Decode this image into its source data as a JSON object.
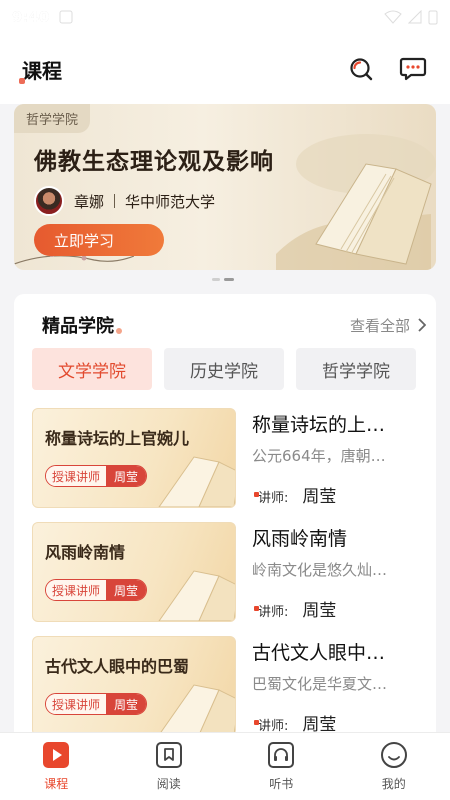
{
  "status": {
    "time": "9:40"
  },
  "header": {
    "title": "课程"
  },
  "banner": {
    "tag": "哲学学院",
    "title": "佛教生态理论观及影响",
    "author": "章娜",
    "institution": "华中师范大学",
    "button": "立即学习"
  },
  "section": {
    "title": "精品学院",
    "see_all": "查看全部",
    "tabs": [
      {
        "label": "文学学院",
        "active": true
      },
      {
        "label": "历史学院",
        "active": false
      },
      {
        "label": "哲学学院",
        "active": false
      }
    ]
  },
  "courses": [
    {
      "thumb_title": "称量诗坛的上官婉儿",
      "badge_key": "授课讲师",
      "badge_value": "周莹",
      "title": "称量诗坛的上…",
      "desc": "公元664年，唐朝…",
      "lecturer_label": "讲师:",
      "lecturer": "周莹"
    },
    {
      "thumb_title": "风雨岭南情",
      "badge_key": "授课讲师",
      "badge_value": "周莹",
      "title": "风雨岭南情",
      "desc": "岭南文化是悠久灿…",
      "lecturer_label": "讲师:",
      "lecturer": "周莹"
    },
    {
      "thumb_title": "古代文人眼中的巴蜀",
      "badge_key": "授课讲师",
      "badge_value": "周莹",
      "title": "古代文人眼中…",
      "desc": "巴蜀文化是华夏文…",
      "lecturer_label": "讲师:",
      "lecturer": "周莹"
    }
  ],
  "tabbar": [
    {
      "label": "课程",
      "icon": "play-icon",
      "active": true
    },
    {
      "label": "阅读",
      "icon": "bookmark-icon",
      "active": false
    },
    {
      "label": "听书",
      "icon": "headphones-icon",
      "active": false
    },
    {
      "label": "我的",
      "icon": "smile-icon",
      "active": false
    }
  ],
  "colors": {
    "accent": "#e8472d",
    "tab_active_bg": "#fde3dd"
  }
}
